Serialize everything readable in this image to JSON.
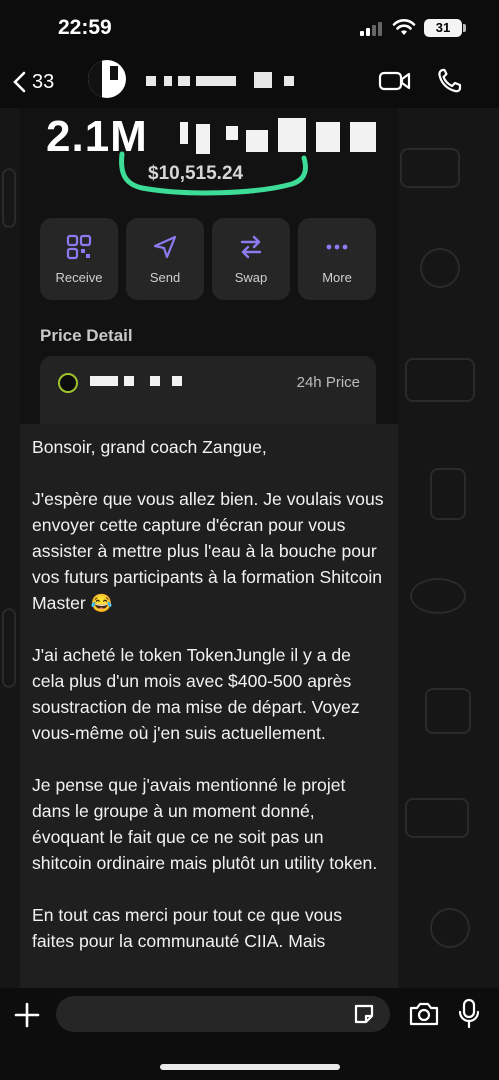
{
  "status": {
    "time": "22:59",
    "battery": "31"
  },
  "header": {
    "back_count": "33"
  },
  "wallet": {
    "balance_prefix": "2.1M",
    "usd_value": "$10,515.24",
    "actions": [
      {
        "label": "Receive",
        "icon": "qr-code-icon"
      },
      {
        "label": "Send",
        "icon": "send-icon"
      },
      {
        "label": "Swap",
        "icon": "swap-icon"
      },
      {
        "label": "More",
        "icon": "more-icon"
      }
    ],
    "price_detail_title": "Price Detail",
    "price_column": "24h Price",
    "highlight_color": "#3ddc97"
  },
  "message": {
    "text": "Bonsoir, grand coach Zangue,\n\nJ'espère que vous allez bien. Je voulais vous envoyer cette capture d'écran pour vous assister à mettre plus l'eau à la bouche pour vos futurs participants à la formation Shitcoin Master 😂\n\nJ'ai acheté le token TokenJungle il y a de cela plus d'un mois avec $400-500 après soustraction de ma mise de départ. Voyez vous-même où j'en suis actuellement.\n\nJe pense que j'avais mentionné le projet dans le groupe à un moment donné, évoquant le fait que ce ne soit pas un shitcoin ordinaire mais plutôt un utility token.\n\nEn tout cas merci pour tout ce que vous faites pour la communauté CIIA. Mais"
  },
  "compose": {
    "placeholder": ""
  },
  "colors": {
    "accent_green": "#3ddc97",
    "token_ring": "#9fc32c"
  }
}
